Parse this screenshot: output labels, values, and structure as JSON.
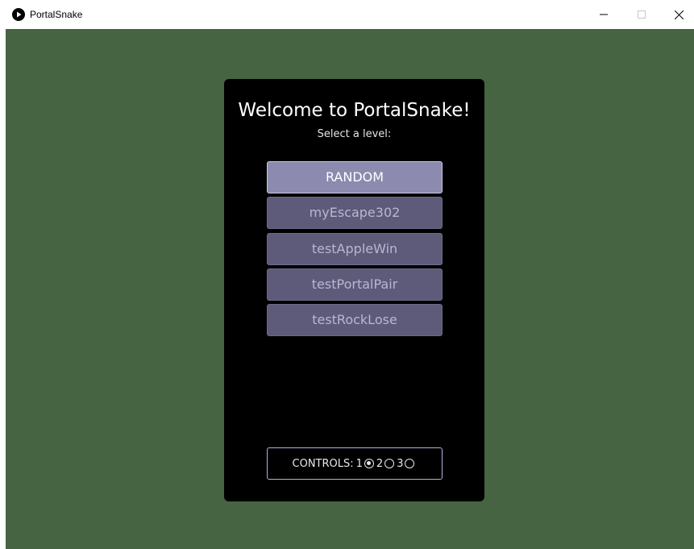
{
  "window": {
    "title": "PortalSnake"
  },
  "menu": {
    "welcome": "Welcome to PortalSnake!",
    "subtitle": "Select a level:",
    "levels": [
      {
        "label": "RANDOM",
        "selected": true
      },
      {
        "label": "myEscape302",
        "selected": false
      },
      {
        "label": "testAppleWin",
        "selected": false
      },
      {
        "label": "testPortalPair",
        "selected": false
      },
      {
        "label": "testRockLose",
        "selected": false
      }
    ],
    "controls": {
      "label": "CONTROLS:",
      "options": [
        "1",
        "2",
        "3"
      ],
      "selected": "1"
    }
  },
  "colors": {
    "background": "#466441",
    "panel": "#000000",
    "button": "#5d5a7a",
    "button_selected": "#8c8aae"
  }
}
